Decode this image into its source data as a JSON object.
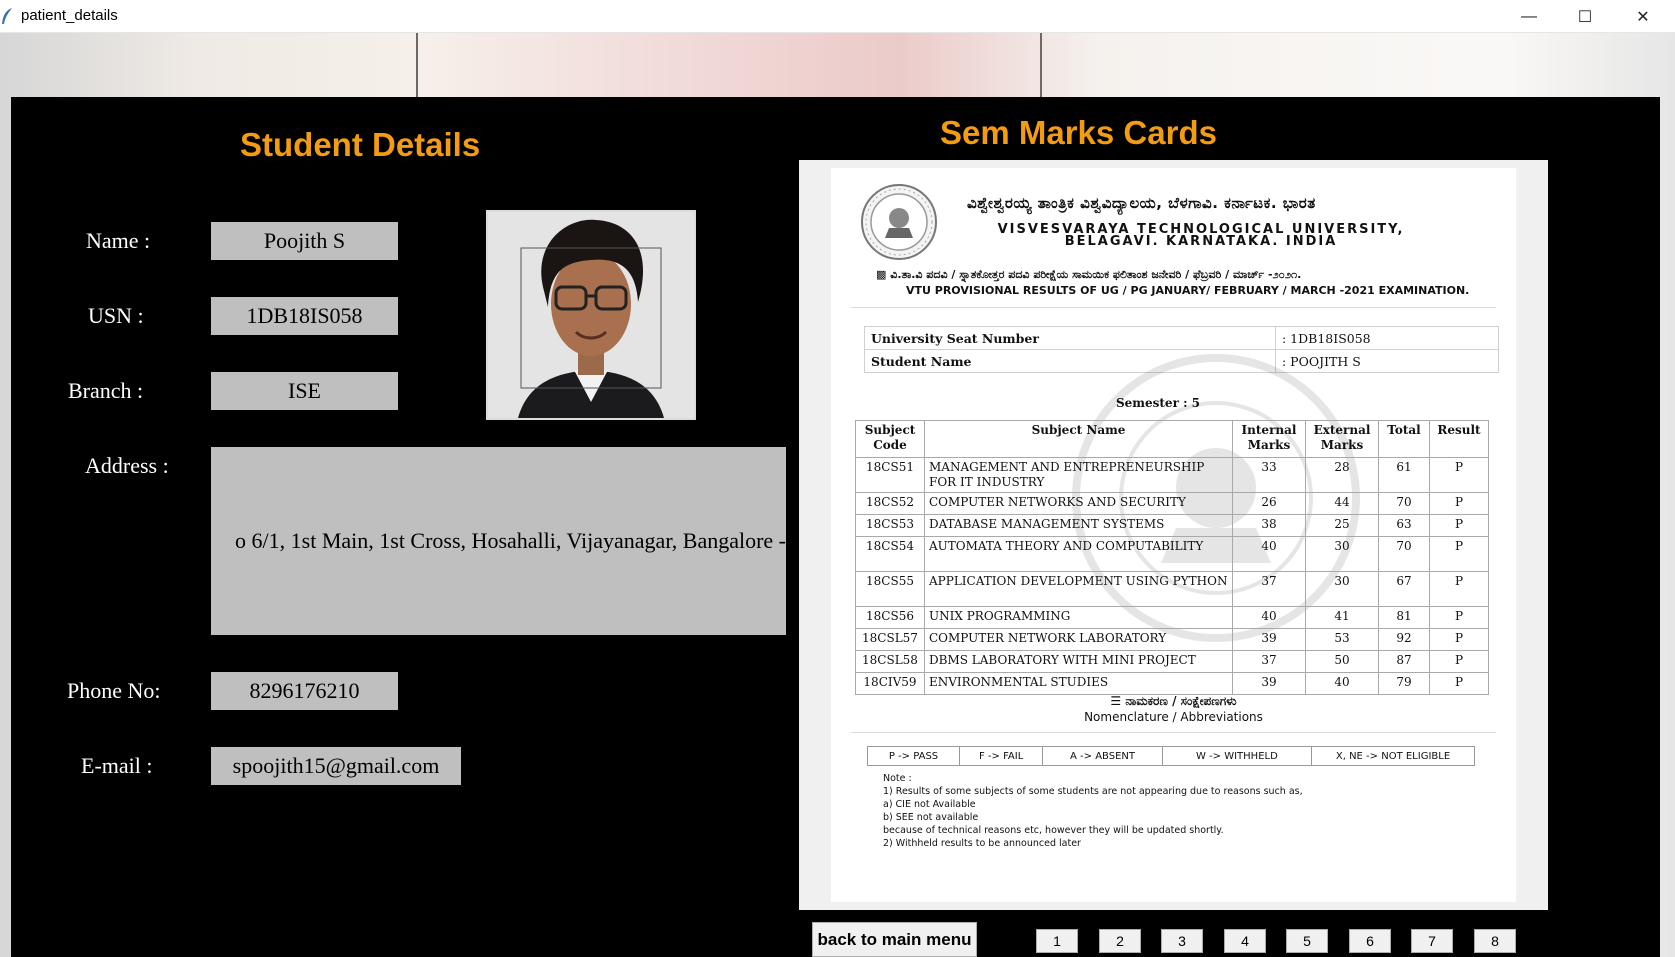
{
  "window": {
    "title": "patient_details",
    "minimize": "—",
    "maximize": "☐",
    "close": "✕"
  },
  "student": {
    "heading": "Student Details",
    "name_label": "Name :",
    "name": "Poojith S",
    "usn_label": "USN :",
    "usn": "1DB18IS058",
    "branch_label": "Branch :",
    "branch": "ISE",
    "address_label": "Address :",
    "address": "o 6/1, 1st Main, 1st Cross, Hosahalli, Vijayanagar, Bangalore -",
    "phone_label": "Phone No:",
    "phone": "8296176210",
    "email_label": "E-mail :",
    "email": "spoojith15@gmail.com"
  },
  "marks_card": {
    "heading": "Sem Marks Cards",
    "university_kn": "ವಿಶ್ವೇಶ್ವರಯ್ಯ ತಾಂತ್ರಿಕ ವಿಶ್ವವಿದ್ಯಾಲಯ, ಬೆಳಗಾವಿ. ಕರ್ನಾಟಕ. ಭಾರತ",
    "university_en_1": "VISVESVARAYA TECHNOLOGICAL UNIVERSITY,",
    "university_en_2": "BELAGAVI. KARNATAKA. INDIA",
    "results_kn": "▩ ವಿ.ತಾ.ವಿ ಪದವಿ / ಸ್ನಾತಕೋತ್ತರ ಪದವಿ ಪರೀಕ್ಷೆಯ ಸಾಮಯಿಕ ಫಲಿತಾಂಶ ಜನೇವರಿ / ಫೆಬ್ರವರಿ / ಮಾರ್ಚ್ -೨೦೨೧.",
    "results_en": "VTU PROVISIONAL RESULTS OF UG / PG JANUARY/ FEBRUARY / MARCH -2021 EXAMINATION.",
    "seat_label": "University Seat Number",
    "seat_value": ": 1DB18IS058",
    "student_label": "Student Name",
    "student_value": ": POOJITH S",
    "semester": "Semester : 5",
    "columns": [
      "Subject Code",
      "Subject Name",
      "Internal Marks",
      "External Marks",
      "Total",
      "Result"
    ],
    "rows": [
      {
        "code": "18CS51",
        "name": "MANAGEMENT AND ENTREPRENEURSHIP FOR IT INDUSTRY",
        "internal": "33",
        "external": "28",
        "total": "61",
        "result": "P"
      },
      {
        "code": "18CS52",
        "name": "COMPUTER NETWORKS AND SECURITY",
        "internal": "26",
        "external": "44",
        "total": "70",
        "result": "P"
      },
      {
        "code": "18CS53",
        "name": "DATABASE MANAGEMENT SYSTEMS",
        "internal": "38",
        "external": "25",
        "total": "63",
        "result": "P"
      },
      {
        "code": "18CS54",
        "name": "AUTOMATA THEORY AND COMPUTABILITY",
        "internal": "40",
        "external": "30",
        "total": "70",
        "result": "P"
      },
      {
        "code": "18CS55",
        "name": "APPLICATION DEVELOPMENT USING PYTHON",
        "internal": "37",
        "external": "30",
        "total": "67",
        "result": "P"
      },
      {
        "code": "18CS56",
        "name": "UNIX PROGRAMMING",
        "internal": "40",
        "external": "41",
        "total": "81",
        "result": "P"
      },
      {
        "code": "18CSL57",
        "name": "COMPUTER NETWORK LABORATORY",
        "internal": "39",
        "external": "53",
        "total": "92",
        "result": "P"
      },
      {
        "code": "18CSL58",
        "name": "DBMS LABORATORY WITH MINI PROJECT",
        "internal": "37",
        "external": "50",
        "total": "87",
        "result": "P"
      },
      {
        "code": "18CIV59",
        "name": "ENVIRONMENTAL STUDIES",
        "internal": "39",
        "external": "40",
        "total": "79",
        "result": "P"
      }
    ],
    "nomenclature_kn": "☰ ನಾಮಕರಣ / ಸಂಕ್ಷೇಪಣಗಳು",
    "nomenclature_en": "Nomenclature / Abbreviations",
    "abbreviations": [
      "P -> PASS",
      "F -> FAIL",
      "A -> ABSENT",
      "W -> WITHHELD",
      "X, NE -> NOT ELIGIBLE"
    ],
    "notes": "Note :\n1) Results of some subjects of some students are not appearing due to reasons such as,\na) CIE not Available\nb) SEE not available\nbecause of technical reasons etc, however they will be updated shortly.\n2) Withheld results to be announced later"
  },
  "controls": {
    "back": "back to main menu",
    "pages": [
      "1",
      "2",
      "3",
      "4",
      "5",
      "6",
      "7",
      "8"
    ]
  },
  "colors": {
    "panel": "#000000",
    "heading": "#f39c12",
    "field": "#bfbfbf"
  }
}
